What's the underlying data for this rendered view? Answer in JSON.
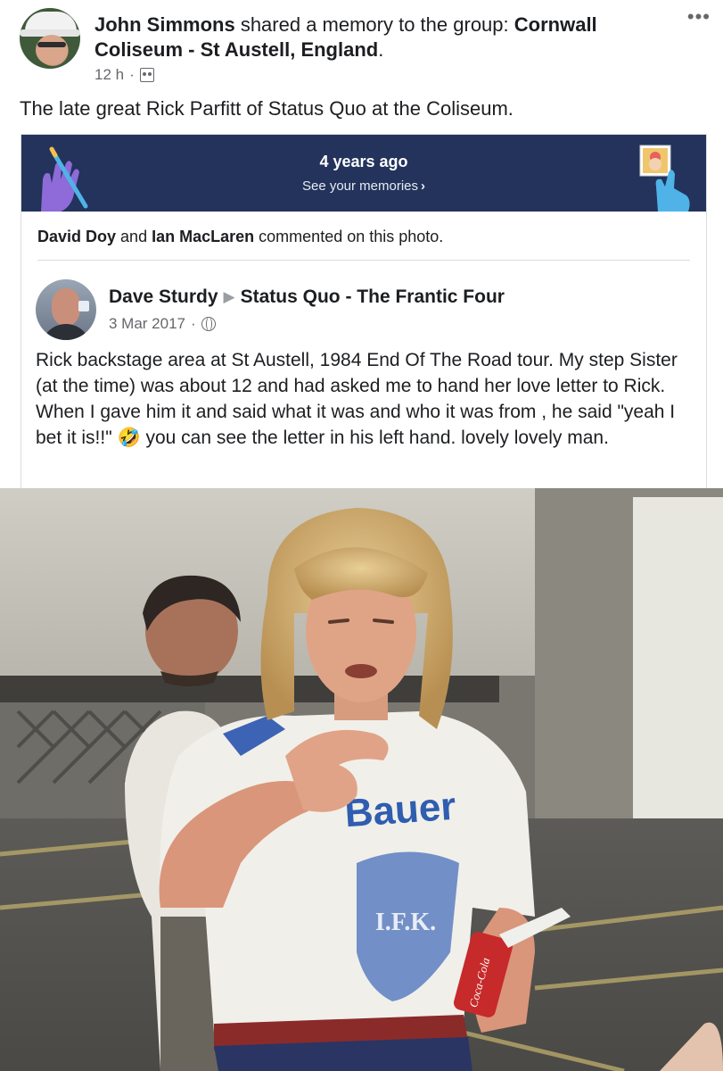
{
  "post": {
    "author": "John Simmons",
    "action": "shared a memory to the group:",
    "group": "Cornwall Coliseum - St Austell, England",
    "period": ".",
    "time": "12 h",
    "separator": "·",
    "more_label": "•••",
    "caption": "The late great Rick Parfitt of Status Quo at the Coliseum."
  },
  "memory": {
    "title": "4 years ago",
    "link": "See your memories",
    "link_chevron": "›",
    "commenter1": "David Doy",
    "conj": "and",
    "commenter2": "Ian MacLaren",
    "comment_suffix": "commented on this photo."
  },
  "shared_post": {
    "author": "Dave Sturdy",
    "arrow": "▶",
    "target": "Status Quo - The Frantic Four",
    "date": "3 Mar 2017",
    "separator": "·",
    "text": "Rick backstage area at St Austell, 1984 End Of The Road tour. My step Sister (at the time) was about 12 and had asked me to hand her love letter to Rick. When I gave him it and said what it was and who it was from , he said \"yeah I bet it is!!\" 🤣 you can see the letter in his left hand. lovely lovely man."
  },
  "photo": {
    "shirt_text": "Bauer",
    "shield_text": "I.F.K.",
    "can_text": "Coca-Cola"
  },
  "colors": {
    "banner": "#23335c",
    "meta_gray": "#65676b",
    "text": "#1c1e21"
  }
}
